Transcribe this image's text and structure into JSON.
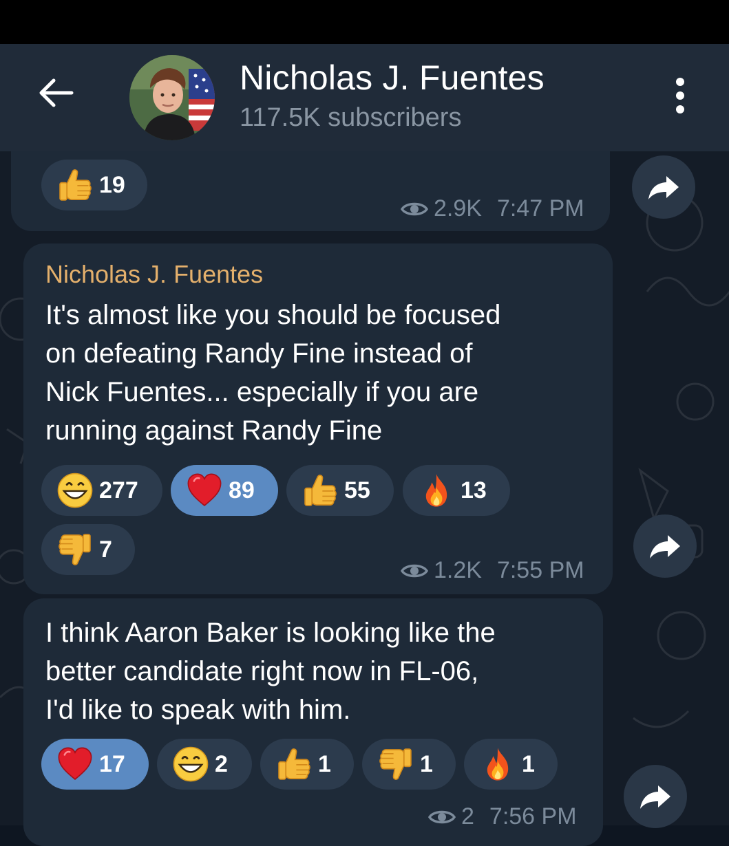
{
  "header": {
    "channel_name": "Nicholas J. Fuentes",
    "subscribers": "117.5K subscribers",
    "back_icon": "arrow-left-icon",
    "menu_icon": "more-vertical-icon"
  },
  "colors": {
    "header_bg": "#202b39",
    "chat_bg": "#141c27",
    "bubble_bg": "#1e2a38",
    "reaction_bg": "#2c3b4d",
    "reaction_chosen_bg": "#5b8ac2",
    "sender_name": "#e4b06c",
    "meta_text": "#7c8b9b"
  },
  "messages": [
    {
      "reactions": [
        {
          "emoji": "thumbs-up",
          "count": "19",
          "chosen": false
        }
      ],
      "views": "2.9K",
      "time": "7:47 PM"
    },
    {
      "sender": "Nicholas J. Fuentes",
      "text_lines": [
        "It's almost like you should be focused",
        "on defeating Randy Fine instead of",
        "Nick Fuentes... especially if you are",
        "running against Randy Fine"
      ],
      "reactions": [
        {
          "emoji": "grinning-face",
          "count": "277",
          "chosen": false
        },
        {
          "emoji": "red-heart",
          "count": "89",
          "chosen": true
        },
        {
          "emoji": "thumbs-up",
          "count": "55",
          "chosen": false
        },
        {
          "emoji": "fire",
          "count": "13",
          "chosen": false
        },
        {
          "emoji": "thumbs-down",
          "count": "7",
          "chosen": false
        }
      ],
      "views": "1.2K",
      "time": "7:55 PM"
    },
    {
      "text_lines": [
        "I think Aaron Baker is looking like the",
        "better candidate right now in FL-06,",
        "I'd like to speak with him."
      ],
      "reactions": [
        {
          "emoji": "red-heart",
          "count": "17",
          "chosen": true
        },
        {
          "emoji": "grinning-face",
          "count": "2",
          "chosen": false
        },
        {
          "emoji": "thumbs-up",
          "count": "1",
          "chosen": false
        },
        {
          "emoji": "thumbs-down",
          "count": "1",
          "chosen": false
        },
        {
          "emoji": "fire",
          "count": "1",
          "chosen": false
        }
      ],
      "views": "2",
      "time": "7:56 PM"
    }
  ]
}
